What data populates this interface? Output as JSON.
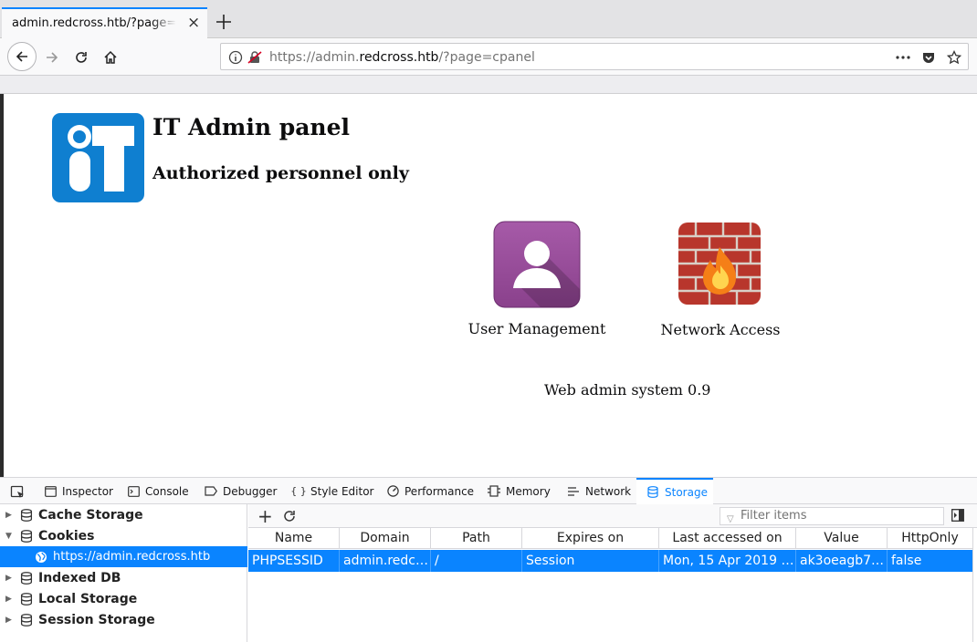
{
  "browser": {
    "tab_title": "admin.redcross.htb/?page=cpanel",
    "url_prefix": "https://admin.",
    "url_host": "redcross.htb",
    "url_suffix": "/?page=cpanel"
  },
  "page": {
    "title": "IT Admin panel",
    "subtitle": "Authorized personnel only",
    "apps": [
      {
        "label": "User Management",
        "icon": "user-icon"
      },
      {
        "label": "Network Access",
        "icon": "firewall-icon"
      }
    ],
    "footer": "Web admin system 0.9"
  },
  "devtools": {
    "tabs": [
      {
        "label": "Inspector",
        "icon": "inspector-icon"
      },
      {
        "label": "Console",
        "icon": "console-icon"
      },
      {
        "label": "Debugger",
        "icon": "debugger-icon"
      },
      {
        "label": "Style Editor",
        "icon": "style-editor-icon"
      },
      {
        "label": "Performance",
        "icon": "performance-icon"
      },
      {
        "label": "Memory",
        "icon": "memory-icon"
      },
      {
        "label": "Network",
        "icon": "network-icon"
      },
      {
        "label": "Storage",
        "icon": "storage-icon",
        "active": true
      }
    ],
    "sidebar": [
      {
        "label": "Cache Storage",
        "expanded": false
      },
      {
        "label": "Cookies",
        "expanded": true
      },
      {
        "label": "https://admin.redcross.htb",
        "selected": true
      },
      {
        "label": "Indexed DB",
        "expanded": false
      },
      {
        "label": "Local Storage",
        "expanded": false
      },
      {
        "label": "Session Storage",
        "expanded": false
      }
    ],
    "filter_placeholder": "Filter items",
    "columns": [
      "Name",
      "Domain",
      "Path",
      "Expires on",
      "Last accessed on",
      "Value",
      "HttpOnly"
    ],
    "rows": [
      [
        "PHPSESSID",
        "admin.redcross.htb",
        "/",
        "Session",
        "Mon, 15 Apr 2019 2…",
        "ak3oeagb7p…",
        "false"
      ]
    ]
  },
  "colors": {
    "accent": "#0a84ff",
    "logo_blue": "#0f7fd0",
    "user_purple": "#9b4f9d"
  }
}
